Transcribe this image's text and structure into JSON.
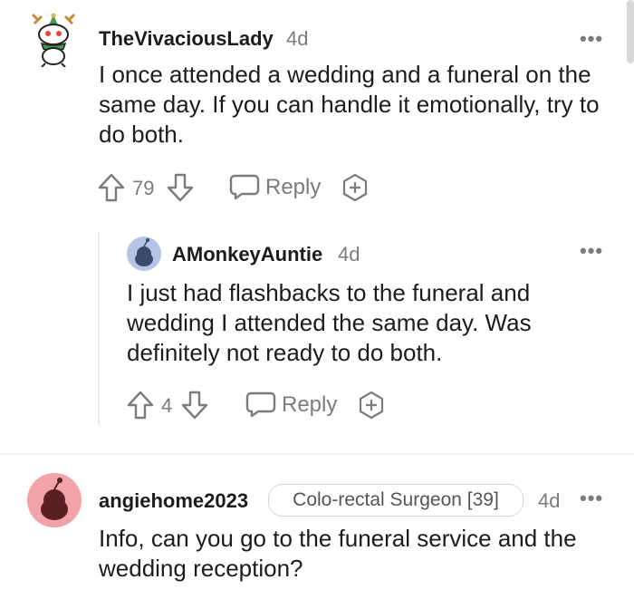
{
  "comments": [
    {
      "username": "TheVivaciousLady",
      "time": "4d",
      "body": "I once attended a wedding and a funeral on the same day. If you can handle it emotionally, try to do both.",
      "votes": "79",
      "reply_label": "Reply"
    },
    {
      "username": "AMonkeyAuntie",
      "time": "4d",
      "body": "I just had flashbacks to the funeral and wedding I attended the same day. Was definitely not ready to do both.",
      "votes": "4",
      "reply_label": "Reply"
    },
    {
      "username": "angiehome2023",
      "flair": "Colo-rectal Surgeon [39]",
      "time": "4d",
      "body": "Info, can you go to the funeral service and the wedding reception?"
    }
  ],
  "more_glyph": "•••"
}
